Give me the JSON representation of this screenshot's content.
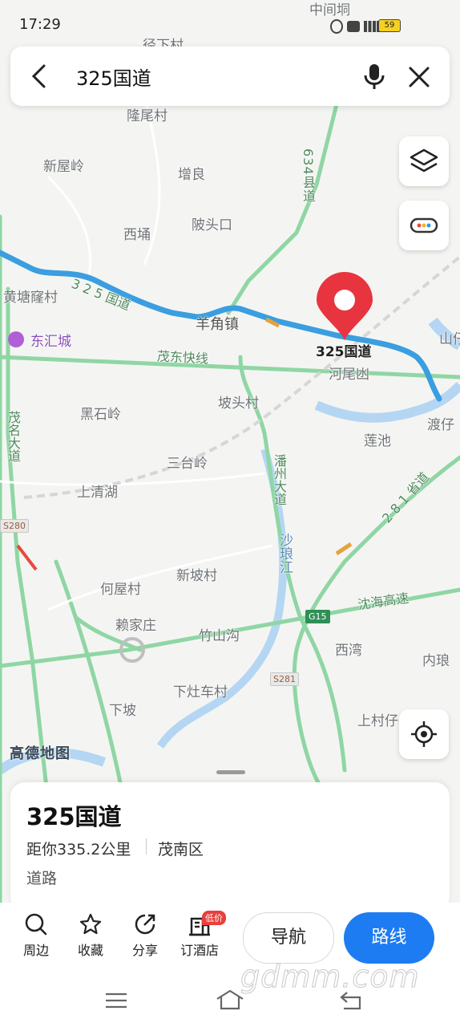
{
  "status_bar": {
    "time": "17:29",
    "battery": "59"
  },
  "search": {
    "query": "325国道"
  },
  "map": {
    "pin_label": "325国道",
    "places": [
      "隆尾村",
      "新屋岭",
      "增良",
      "西埇",
      "陂头口",
      "黄塘窿村",
      "羊角镇",
      "河尾凼",
      "坡头村",
      "黑石岭",
      "莲池",
      "三台岭",
      "上清湖",
      "何屋村",
      "新坡村",
      "赖家庄",
      "竹山沟",
      "西湾",
      "内琅",
      "下灶车村",
      "下坡",
      "上村仔",
      "渡仔",
      "径下村",
      "中间垌",
      "山仔"
    ],
    "roads": {
      "national_325": "3 2 5 国道",
      "county_634": "6 3 4 县 道",
      "maodong_expressway": "茂东快线",
      "panzhou_avenue": "潘州大道",
      "shalang_river": "沙琅江",
      "provincial_281": "2 8 1 省道",
      "shenhai_expressway": "沈海高速",
      "maoming_avenue": "茂名大道"
    },
    "badges": {
      "s280": "S280",
      "s281": "S281",
      "g15": "G15"
    },
    "poi": "东汇城",
    "logo": "高德地图"
  },
  "place_card": {
    "title": "325国道",
    "distance": "距你335.2公里",
    "district": "茂南区",
    "type": "道路"
  },
  "actions": {
    "nearby": "周边",
    "favorite": "收藏",
    "share": "分享",
    "hotel": "订酒店",
    "hotel_badge": "低价",
    "navigate": "导航",
    "route": "路线"
  },
  "watermark": "gdmm.com",
  "colors": {
    "route": "#3a9ee0",
    "road": "#8fd6a4",
    "pin": "#e8343f",
    "accent": "#1e7cf2"
  }
}
